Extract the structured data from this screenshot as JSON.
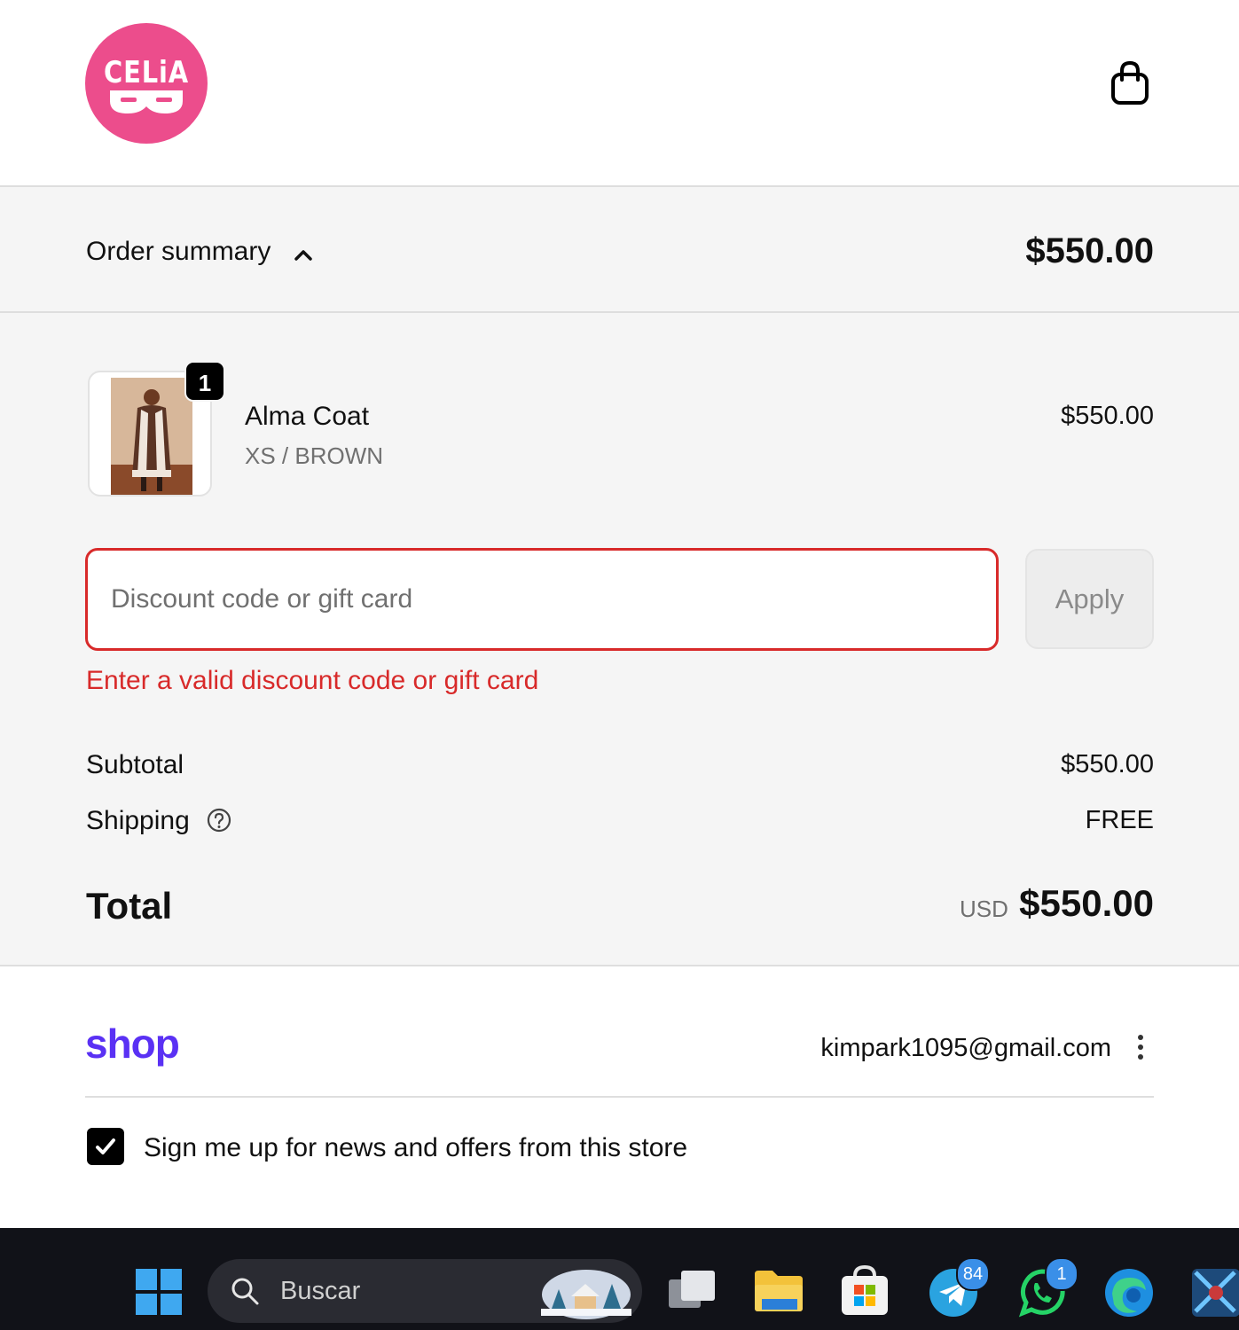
{
  "header": {
    "logo_text": "CELiA",
    "cart_icon": "shopping-bag-icon"
  },
  "summary": {
    "label": "Order summary",
    "toggle_icon": "chevron-up-icon",
    "total": "$550.00"
  },
  "line_items": [
    {
      "quantity": "1",
      "name": "Alma Coat",
      "variant": "XS / BROWN",
      "price": "$550.00"
    }
  ],
  "discount": {
    "placeholder": "Discount code or gift card",
    "value": "",
    "apply_label": "Apply",
    "error": "Enter a valid discount code or gift card"
  },
  "totals": {
    "subtotal_label": "Subtotal",
    "subtotal_value": "$550.00",
    "shipping_label": "Shipping",
    "shipping_value": "FREE",
    "total_label": "Total",
    "currency": "USD",
    "total_value": "$550.00"
  },
  "shop_pay": {
    "brand": "shop",
    "email": "kimpark1095@gmail.com",
    "menu_icon": "kebab-menu-icon"
  },
  "newsletter": {
    "checked": true,
    "label": "Sign me up for news and offers from this store"
  },
  "taskbar": {
    "search_placeholder": "Buscar",
    "telegram_badge": "84",
    "whatsapp_badge": "1"
  },
  "colors": {
    "brand_pink": "#ec4d8c",
    "error_red": "#d82a2a",
    "shop_purple": "#5a31f4"
  }
}
